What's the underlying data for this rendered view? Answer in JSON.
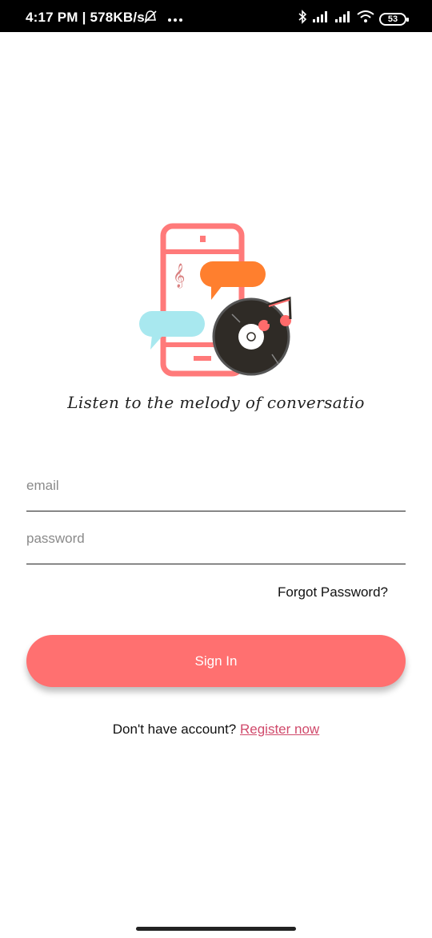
{
  "status_bar": {
    "time": "4:17 PM | 578KB/s",
    "battery": "53",
    "icons": [
      "alarm-off-icon",
      "more-icon",
      "bluetooth-icon",
      "signal-icon",
      "signal-icon",
      "wifi-icon",
      "battery-icon"
    ]
  },
  "logo": {
    "icon": "chat-music-logo",
    "colors": {
      "phone": "#ff7a7a",
      "bubble_left": "#a8e8ef",
      "bubble_right": "#ff7f2e",
      "record": "#2f2b26"
    }
  },
  "tagline": "Listen to the melody of conversatio",
  "form": {
    "email_placeholder": "email",
    "password_placeholder": "password",
    "forgot_label": "Forgot Password?",
    "signin_label": "Sign In"
  },
  "register": {
    "prompt": "Don't have account?",
    "link": "Register now"
  },
  "colors": {
    "accent": "#ff7070",
    "link": "#d04a6b"
  }
}
